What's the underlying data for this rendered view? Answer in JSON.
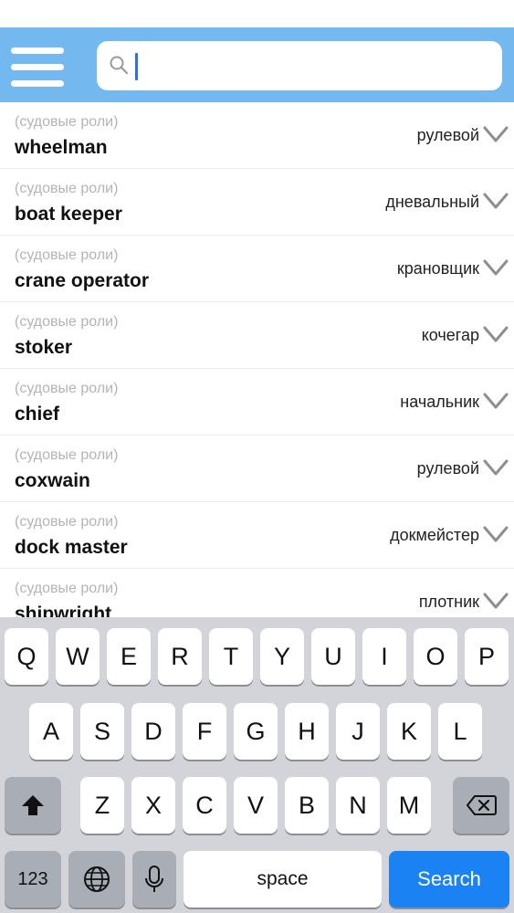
{
  "search": {
    "value": "",
    "placeholder": ""
  },
  "entries": [
    {
      "category": "(судовые роли)",
      "term": "wheelman",
      "translation": "рулевой"
    },
    {
      "category": "(судовые роли)",
      "term": "boat keeper",
      "translation": "дневальный"
    },
    {
      "category": "(судовые роли)",
      "term": "crane operator",
      "translation": "крановщик"
    },
    {
      "category": "(судовые роли)",
      "term": "stoker",
      "translation": "кочегар"
    },
    {
      "category": "(судовые роли)",
      "term": "chief",
      "translation": "начальник"
    },
    {
      "category": "(судовые роли)",
      "term": "coxwain",
      "translation": "рулевой"
    },
    {
      "category": "(судовые роли)",
      "term": "dock master",
      "translation": "докмейстер"
    },
    {
      "category": "(судовые роли)",
      "term": "shipwright",
      "translation": "плотник"
    }
  ],
  "keyboard": {
    "row1": [
      "Q",
      "W",
      "E",
      "R",
      "T",
      "Y",
      "U",
      "I",
      "O",
      "P"
    ],
    "row2": [
      "A",
      "S",
      "D",
      "F",
      "G",
      "H",
      "J",
      "K",
      "L"
    ],
    "row3": [
      "Z",
      "X",
      "C",
      "V",
      "B",
      "N",
      "M"
    ],
    "numbers_label": "123",
    "space_label": "space",
    "search_label": "Search"
  },
  "colors": {
    "header": "#74b8f0",
    "search_key": "#1a82f2",
    "caret": "#2f6fe0"
  }
}
